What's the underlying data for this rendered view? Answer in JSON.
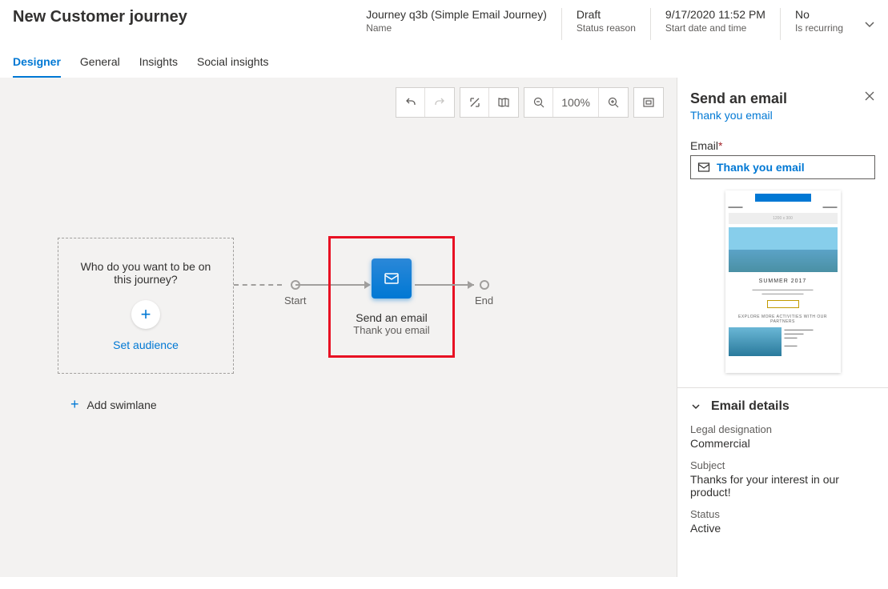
{
  "header": {
    "title": "New Customer journey",
    "meta": {
      "name_value": "Journey q3b (Simple Email Journey)",
      "name_label": "Name",
      "status_value": "Draft",
      "status_label": "Status reason",
      "date_value": "9/17/2020 11:52 PM",
      "date_label": "Start date and time",
      "recurring_value": "No",
      "recurring_label": "Is recurring"
    }
  },
  "tabs": {
    "designer": "Designer",
    "general": "General",
    "insights": "Insights",
    "social": "Social insights"
  },
  "toolbar": {
    "zoom": "100%"
  },
  "canvas": {
    "audience_question": "Who do you want to be on this journey?",
    "set_audience": "Set audience",
    "start_label": "Start",
    "end_label": "End",
    "tile_title": "Send an email",
    "tile_subtitle": "Thank you email",
    "add_swimlane": "Add swimlane"
  },
  "panel": {
    "title": "Send an email",
    "link": "Thank you email",
    "email_label": "Email",
    "email_value": "Thank you email",
    "preview": {
      "heading": "SUMMER 2017",
      "subhead": "EXPLORE MORE ACTIVITIES WITH OUR PARTNERS"
    },
    "section_title": "Email details",
    "details": {
      "legal_label": "Legal designation",
      "legal_value": "Commercial",
      "subject_label": "Subject",
      "subject_value": "Thanks for your interest in our product!",
      "status_label": "Status",
      "status_value": "Active"
    }
  }
}
